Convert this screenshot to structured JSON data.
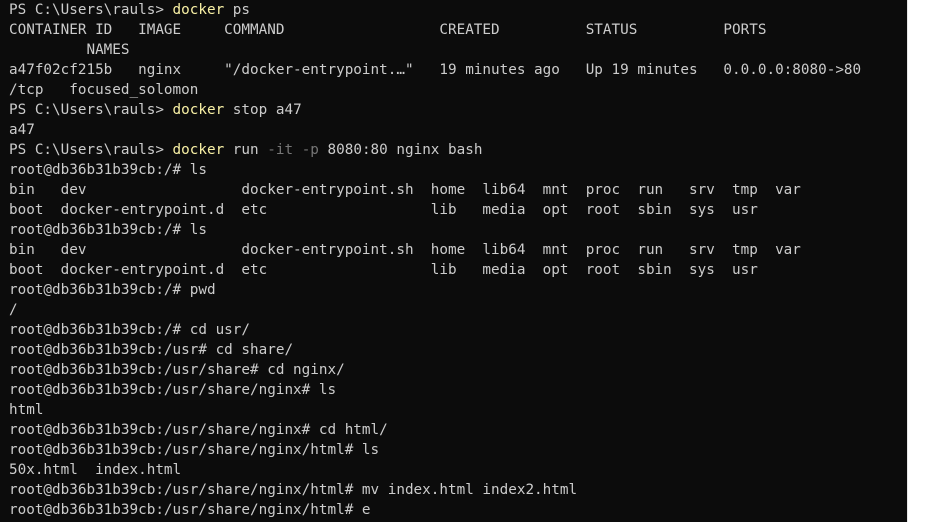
{
  "terminal": {
    "lines": [
      [
        {
          "t": "PS C:\\Users\\rauls> ",
          "c": "text"
        },
        {
          "t": "docker",
          "c": "cmd"
        },
        {
          "t": " ps",
          "c": "arg"
        }
      ],
      [
        {
          "t": "CONTAINER ID   IMAGE     COMMAND                  CREATED          STATUS          PORTS",
          "c": "text"
        }
      ],
      [
        {
          "t": "         NAMES",
          "c": "text"
        }
      ],
      [
        {
          "t": "a47f02cf215b   nginx     \"/docker-entrypoint.…\"   19 minutes ago   Up 19 minutes   0.0.0.0:8080->80",
          "c": "text"
        }
      ],
      [
        {
          "t": "/tcp   focused_solomon",
          "c": "text"
        }
      ],
      [
        {
          "t": "PS C:\\Users\\rauls> ",
          "c": "text"
        },
        {
          "t": "docker",
          "c": "cmd"
        },
        {
          "t": " stop a47",
          "c": "arg"
        }
      ],
      [
        {
          "t": "a47",
          "c": "text"
        }
      ],
      [
        {
          "t": "PS C:\\Users\\rauls> ",
          "c": "text"
        },
        {
          "t": "docker",
          "c": "cmd"
        },
        {
          "t": " run ",
          "c": "arg"
        },
        {
          "t": "-it",
          "c": "flag"
        },
        {
          "t": " ",
          "c": "arg"
        },
        {
          "t": "-p",
          "c": "flag"
        },
        {
          "t": " 8080:80 nginx bash",
          "c": "arg"
        }
      ],
      [
        {
          "t": "root@db36b31b39cb:/# ls",
          "c": "text"
        }
      ],
      [
        {
          "t": "bin   dev                  docker-entrypoint.sh  home  lib64  mnt  proc  run   srv  tmp  var",
          "c": "text"
        }
      ],
      [
        {
          "t": "boot  docker-entrypoint.d  etc                   lib   media  opt  root  sbin  sys  usr",
          "c": "text"
        }
      ],
      [
        {
          "t": "root@db36b31b39cb:/# ls",
          "c": "text"
        }
      ],
      [
        {
          "t": "bin   dev                  docker-entrypoint.sh  home  lib64  mnt  proc  run   srv  tmp  var",
          "c": "text"
        }
      ],
      [
        {
          "t": "boot  docker-entrypoint.d  etc                   lib   media  opt  root  sbin  sys  usr",
          "c": "text"
        }
      ],
      [
        {
          "t": "root@db36b31b39cb:/# pwd",
          "c": "text"
        }
      ],
      [
        {
          "t": "/",
          "c": "text"
        }
      ],
      [
        {
          "t": "root@db36b31b39cb:/# cd usr/",
          "c": "text"
        }
      ],
      [
        {
          "t": "root@db36b31b39cb:/usr# cd share/",
          "c": "text"
        }
      ],
      [
        {
          "t": "root@db36b31b39cb:/usr/share# cd nginx/",
          "c": "text"
        }
      ],
      [
        {
          "t": "root@db36b31b39cb:/usr/share/nginx# ls",
          "c": "text"
        }
      ],
      [
        {
          "t": "html",
          "c": "text"
        }
      ],
      [
        {
          "t": "root@db36b31b39cb:/usr/share/nginx# cd html/",
          "c": "text"
        }
      ],
      [
        {
          "t": "root@db36b31b39cb:/usr/share/nginx/html# ls",
          "c": "text"
        }
      ],
      [
        {
          "t": "50x.html  index.html",
          "c": "text"
        }
      ],
      [
        {
          "t": "root@db36b31b39cb:/usr/share/nginx/html# mv index.html index2.html",
          "c": "text"
        }
      ],
      [
        {
          "t": "root@db36b31b39cb:/usr/share/nginx/html# e",
          "c": "text"
        }
      ]
    ]
  }
}
